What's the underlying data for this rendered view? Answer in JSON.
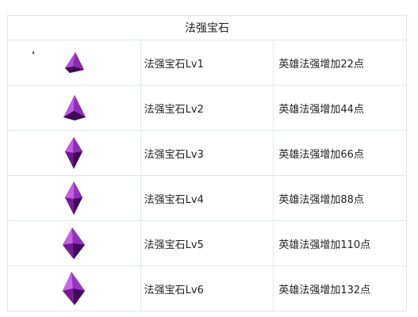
{
  "table": {
    "header": "法强宝石",
    "gem_color": "#7a1a9e",
    "rows": [
      {
        "name": "法强宝石Lv1",
        "effect": "英雄法强增加22点",
        "icon": "purple-gem-lv1-icon"
      },
      {
        "name": "法强宝石Lv2",
        "effect": "英雄法强增加44点",
        "icon": "purple-gem-lv2-icon"
      },
      {
        "name": "法强宝石Lv3",
        "effect": "英雄法强增加66点",
        "icon": "purple-gem-lv3-icon"
      },
      {
        "name": "法强宝石Lv4",
        "effect": "英雄法强增加88点",
        "icon": "purple-gem-lv4-icon"
      },
      {
        "name": "法强宝石Lv5",
        "effect": "英雄法强增加110点",
        "icon": "purple-gem-lv5-icon"
      },
      {
        "name": "法强宝石Lv6",
        "effect": "英雄法强增加132点",
        "icon": "purple-gem-lv6-icon"
      }
    ]
  }
}
